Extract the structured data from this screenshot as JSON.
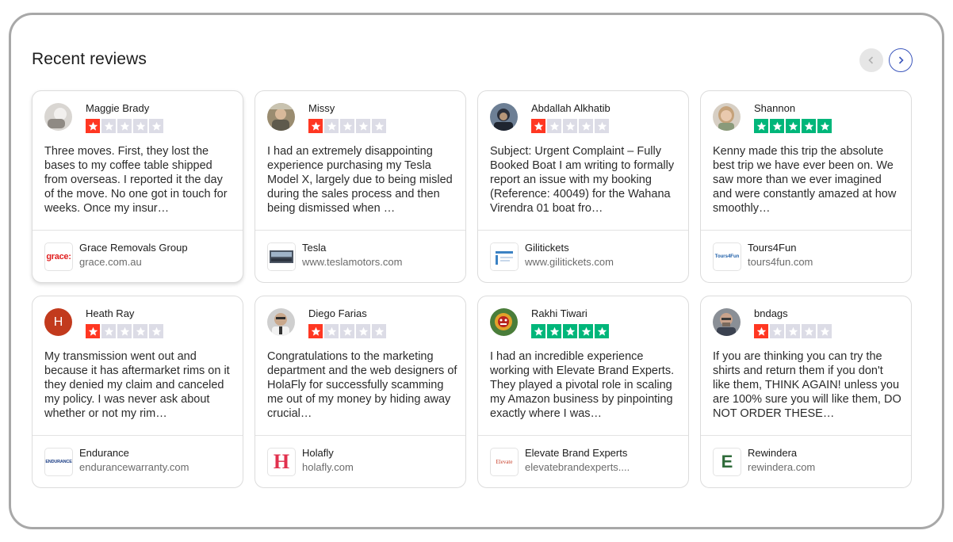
{
  "header": {
    "title": "Recent reviews"
  },
  "colors": {
    "star_red": "#ff3722",
    "star_green": "#00b67a",
    "star_empty": "#dcdce6",
    "nav_border": "#3c57bc"
  },
  "reviews": [
    {
      "reviewer": "Maggie Brady",
      "rating": 1,
      "text": "Three moves. First, they lost the bases to my coffee table shipped from overseas. I reported it the day of the move. No one got in touch for weeks. Once my insur…",
      "business": "Grace Removals Group",
      "domain": "grace.com.au",
      "logo_text": "grace:"
    },
    {
      "reviewer": "Missy",
      "rating": 1,
      "text": "I had an extremely disappointing experience purchasing my Tesla Model X, largely due to being misled during the sales process and then being dismissed when …",
      "business": "Tesla",
      "domain": "www.teslamotors.com",
      "logo_text": ""
    },
    {
      "reviewer": "Abdallah Alkhatib",
      "rating": 1,
      "text": "Subject: Urgent Complaint – Fully Booked Boat I am writing to formally report an issue with my booking (Reference: 40049) for the Wahana Virendra 01 boat fro…",
      "business": "Gilitickets",
      "domain": "www.gilitickets.com",
      "logo_text": ""
    },
    {
      "reviewer": "Shannon",
      "rating": 5,
      "text": "Kenny made this trip the absolute best trip we have ever been on. We saw more than we ever imagined and were constantly amazed at how smoothly…",
      "business": "Tours4Fun",
      "domain": "tours4fun.com",
      "logo_text": "Tours4Fun"
    },
    {
      "reviewer": "Heath Ray",
      "rating": 1,
      "avatar_letter": "H",
      "text": "My transmission went out and because it has aftermarket rims on it they denied my claim and canceled my policy. I was never ask about whether or not my rim…",
      "business": "Endurance",
      "domain": "endurancewarranty.com",
      "logo_text": "ENDURANCE"
    },
    {
      "reviewer": "Diego Farias",
      "rating": 1,
      "text": "Congratulations to the marketing department and the web designers of HolaFly for successfully scamming me out of my money by hiding away crucial…",
      "business": "Holafly",
      "domain": "holafly.com",
      "logo_text": "H"
    },
    {
      "reviewer": "Rakhi Tiwari",
      "rating": 5,
      "text": "I had an incredible experience working with Elevate Brand Experts. They played a pivotal role in scaling my Amazon business by pinpointing exactly where I was…",
      "business": "Elevate Brand Experts",
      "domain": "elevatebrandexperts....",
      "logo_text": "Elevate"
    },
    {
      "reviewer": "bndags",
      "rating": 1,
      "text": "If you are thinking you can try the shirts and return them if you don't like them, THINK AGAIN! unless you are 100% sure you will like them, DO NOT ORDER THESE…",
      "business": "Rewindera",
      "domain": "rewindera.com",
      "logo_text": "E"
    }
  ]
}
